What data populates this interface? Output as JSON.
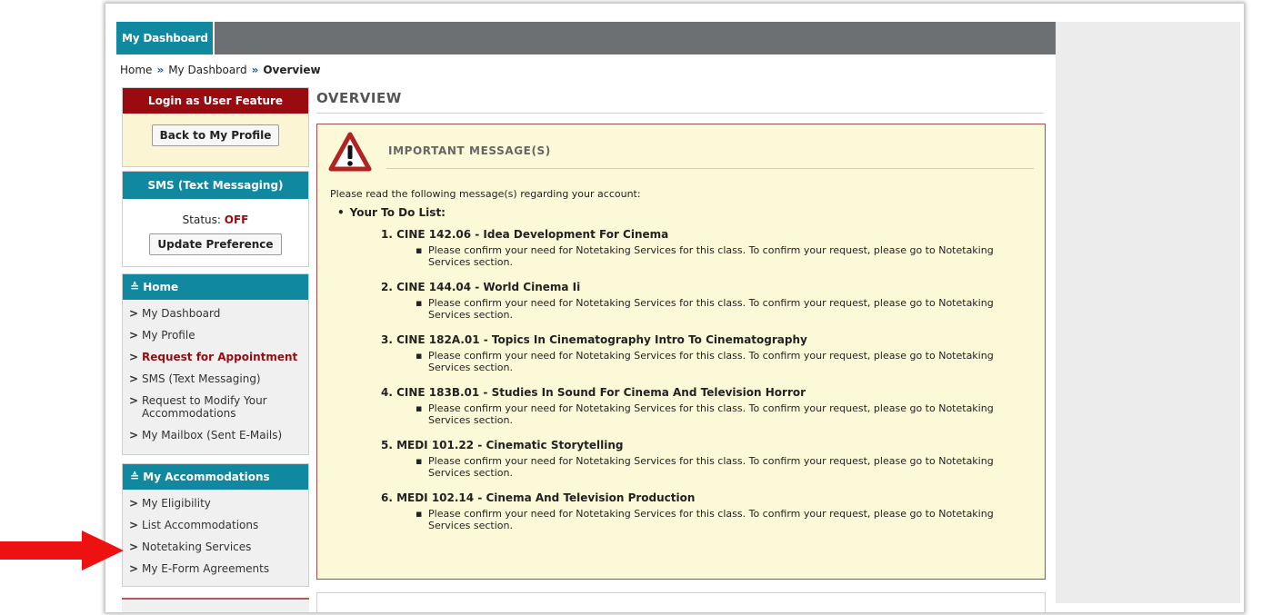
{
  "nav_tab": "My Dashboard",
  "breadcrumb": {
    "home": "Home",
    "dashboard": "My Dashboard",
    "current": "Overview",
    "separator": "»"
  },
  "login_box": {
    "title": "Login as User Feature",
    "button": "Back to My Profile"
  },
  "sms_box": {
    "title": "SMS (Text Messaging)",
    "status_label": "Status:",
    "status_value": "OFF",
    "button": "Update Preference"
  },
  "home_menu": {
    "title": "Home",
    "items": [
      "My Dashboard",
      "My Profile",
      "Request for Appointment",
      "SMS (Text Messaging)",
      "Request to Modify Your Accommodations",
      "My Mailbox (Sent E-Mails)"
    ]
  },
  "acc_menu": {
    "title": "My Accommodations",
    "items": [
      "My Eligibility",
      "List Accommodations",
      "Notetaking Services",
      "My E-Form Agreements"
    ]
  },
  "main": {
    "title": "OVERVIEW",
    "message_heading": "IMPORTANT MESSAGE(S)",
    "intro": "Please read the following message(s) regarding your account:",
    "todo_label": "Your To Do List:",
    "courses": [
      "1. CINE 142.06 - Idea Development For Cinema",
      "2. CINE 144.04 - World Cinema Ii",
      "3. CINE 182A.01 - Topics In Cinematography Intro To Cinematography",
      "4. CINE 183B.01 - Studies In Sound For Cinema And Television Horror",
      "5. MEDI 101.22 - Cinematic Storytelling",
      "6. MEDI 102.14 - Cinema And Television Production"
    ],
    "note": "Please confirm your need for Notetaking Services for this class. To confirm your request, please go to Notetaking Services section."
  },
  "colors": {
    "teal": "#1089a0",
    "maroon": "#9a0b10",
    "yellow_bg": "#fcf9d8",
    "arrow": "#ee1111"
  },
  "icons": {
    "menu_toggle": "double-chevron-down-icon",
    "nav_item": "chevron-right-icon",
    "warning": "warning-triangle-icon",
    "pointer": "red-arrow-icon"
  }
}
